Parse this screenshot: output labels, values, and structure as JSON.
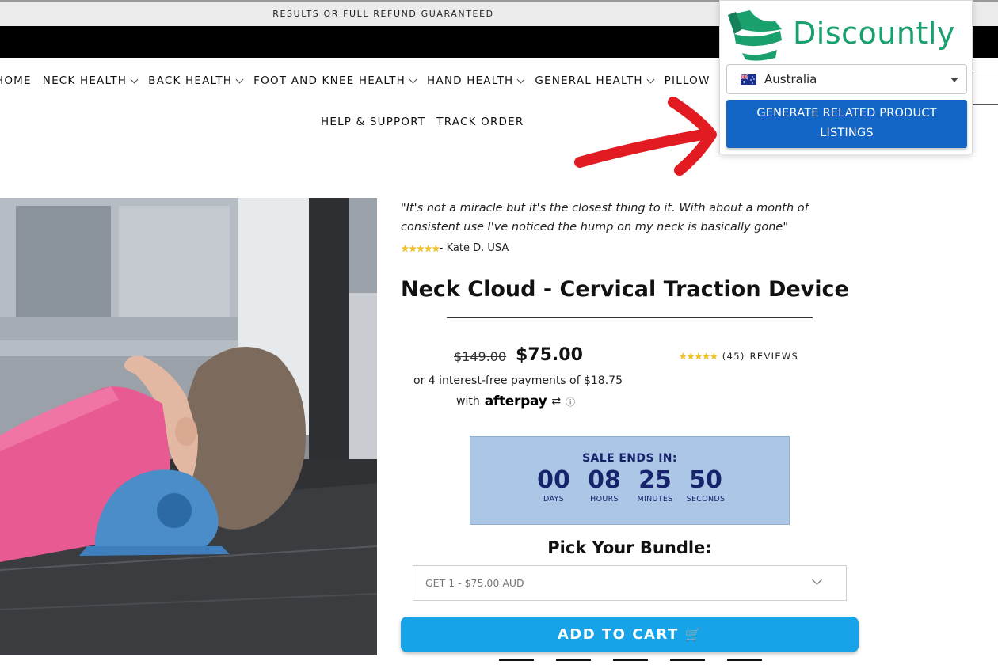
{
  "announcement": "RESULTS OR FULL REFUND GUARANTEED",
  "nav": {
    "items": [
      {
        "label": "HOME",
        "dropdown": false
      },
      {
        "label": "NECK HEALTH",
        "dropdown": true
      },
      {
        "label": "BACK HEALTH",
        "dropdown": true
      },
      {
        "label": "FOOT AND KNEE HEALTH",
        "dropdown": true
      },
      {
        "label": "HAND HEALTH",
        "dropdown": true
      },
      {
        "label": "GENERAL HEALTH",
        "dropdown": true
      },
      {
        "label": "PILLOW",
        "dropdown": false
      }
    ],
    "secondary": [
      "HELP & SUPPORT",
      "TRACK ORDER"
    ]
  },
  "product": {
    "quote_line1": "\"It's not a miracle but it's the closest thing to it. With about a month of",
    "quote_line2": "consistent use I've noticed the hump on my neck is basically gone\"",
    "reviewer": "- Kate D. USA",
    "title": "Neck Cloud - Cervical Traction Device",
    "old_price": "$149.00",
    "price": "$75.00",
    "review_count": "(45)",
    "reviews_label": "REVIEWS",
    "rating": 5,
    "installments": "or 4 interest-free payments of $18.75",
    "afterpay_with": "with",
    "afterpay_brand": "afterpay",
    "afterpay_info": "ⓘ"
  },
  "countdown": {
    "heading": "SALE ENDS IN:",
    "units": [
      {
        "value": "00",
        "label": "DAYS"
      },
      {
        "value": "08",
        "label": "HOURS"
      },
      {
        "value": "25",
        "label": "MINUTES"
      },
      {
        "value": "50",
        "label": "SECONDS"
      }
    ]
  },
  "bundle": {
    "title": "Pick Your Bundle:",
    "selected": "GET 1 - $75.00 AUD"
  },
  "cart": {
    "label": "ADD TO CART",
    "icon": "🛒"
  },
  "discountly": {
    "brand": "Discountly",
    "country": "Australia",
    "button_line1": "GENERATE RELATED PRODUCT",
    "button_line2": "LISTINGS"
  },
  "colors": {
    "brand_green": "#1aa06d",
    "button_blue": "#1466c6",
    "cart_blue": "#16a3e8",
    "countdown_bg": "#acc6e6",
    "countdown_text": "#17246c",
    "arrow_red": "#e21b22"
  }
}
